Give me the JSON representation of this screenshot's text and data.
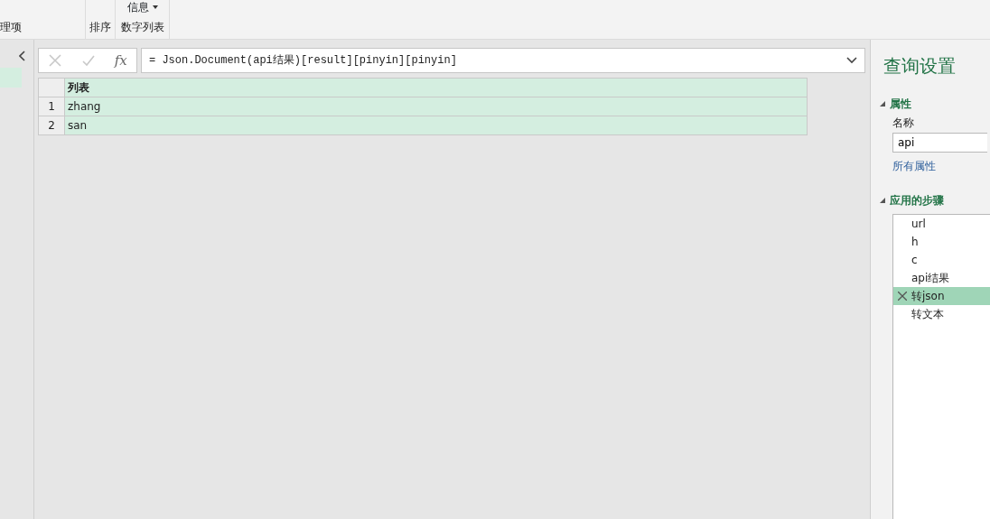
{
  "ribbon": {
    "groups": [
      {
        "label": "理项"
      },
      {
        "label": "排序"
      },
      {
        "top_label": "信息",
        "label": "数字列表"
      }
    ]
  },
  "formula_bar": {
    "buttons": [
      {
        "kind": "cancel",
        "disabled": true
      },
      {
        "kind": "commit",
        "disabled": true
      }
    ],
    "fx_label": "fx",
    "formula": "= Json.Document(api结果)[result][pinyin][pinyin]",
    "expanded": false
  },
  "table": {
    "columns": [
      {
        "label": "列表"
      }
    ],
    "rows": [
      {
        "index": "1",
        "cells": [
          "zhang"
        ]
      },
      {
        "index": "2",
        "cells": [
          "san"
        ]
      }
    ]
  },
  "query_settings": {
    "title": "查询设置",
    "properties": {
      "heading": "属性",
      "expanded": true,
      "name_label": "名称",
      "name_value": "api",
      "link": "所有属性"
    },
    "applied_steps": {
      "heading": "应用的步骤",
      "expanded": true,
      "items": [
        {
          "label": "url",
          "selected": false
        },
        {
          "label": "h",
          "selected": false
        },
        {
          "label": "c",
          "selected": false
        },
        {
          "label": "api结果",
          "selected": false
        },
        {
          "label": "转json",
          "selected": true
        },
        {
          "label": "转文本",
          "selected": false
        }
      ]
    }
  }
}
